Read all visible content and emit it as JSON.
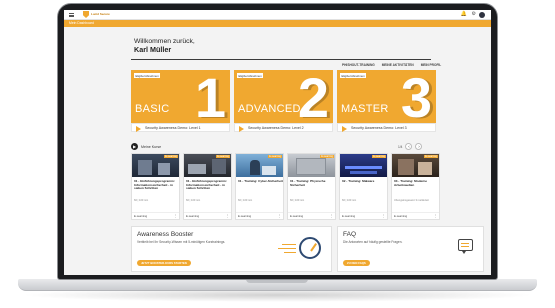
{
  "app": {
    "logo_text": "Lucid Secure",
    "breadcrumb": "Mein Dashboard",
    "icons": [
      "menu-icon",
      "shield-icon",
      "bell-icon",
      "settings-icon",
      "avatar"
    ]
  },
  "welcome": {
    "greeting": "Willkommen zurück,",
    "user_name": "Karl Müller"
  },
  "quicklinks": [
    "PHISHOUT-TRAINING",
    "MEINE AKTIVITÄTEN",
    "MEIN PROFIL"
  ],
  "levels": [
    {
      "tag": "Eligibel Abnehmen",
      "title": "BASIC",
      "number": "1",
      "footer": "Security Awareness Demo: Level 1"
    },
    {
      "tag": "Eligibel Abnehmen",
      "title": "ADVANCED",
      "number": "2",
      "footer": "Security Awareness Demo: Level 2"
    },
    {
      "tag": "Eligibel Abnehmen",
      "title": "MASTER",
      "number": "3",
      "footer": "Security Awareness Demo: Level 3"
    }
  ],
  "courses": {
    "title": "Meine Kurse",
    "pager": "1/4",
    "items": [
      {
        "tag": "E-Learning",
        "title": "01 - Einführungsprogramm: Informationssicherheit - in sieben Schritten",
        "meta": "60 | 100 min",
        "type": "E-Learning"
      },
      {
        "tag": "E-Learning",
        "title": "01 - Einführungsprogramm: Informationssicherheit - in sieben Schritten",
        "meta": "60 | 100 min",
        "type": "E-Learning"
      },
      {
        "tag": "E-Learning",
        "title": "01 - Training: Cyber-Sicherheit",
        "meta": "60 | 100 min",
        "type": "E-Learning"
      },
      {
        "tag": "E-Learning",
        "title": "01 - Training: Physische Sicherheit",
        "meta": "60 | 100 min",
        "type": "E-Learning"
      },
      {
        "tag": "E-Learning",
        "title": "02 - Training: Malware",
        "meta": "60 | 100 min",
        "type": "E-Learning"
      },
      {
        "tag": "E-Learning",
        "title": "03 - Training: Moderne Arbeitswelten",
        "meta": "Ubungsinsgesamt 3 meldezeit",
        "type": "E-Learning"
      }
    ]
  },
  "booster": {
    "title": "Awareness Booster",
    "text": "Verbleib bei Ihr Security-Wissen mit 5-minütigen Kurztrainings.",
    "button": "JETZT BOOSTER-KURS STARTEN"
  },
  "faq": {
    "title": "FAQ",
    "text": "Die Antworten auf häufig gestellte Fragen.",
    "button": "ZU DEN FAQS"
  },
  "colors": {
    "accent": "#f0a830",
    "dark": "#222222",
    "card_bg": "#ffffff",
    "page_bg": "#f3f3f3"
  }
}
